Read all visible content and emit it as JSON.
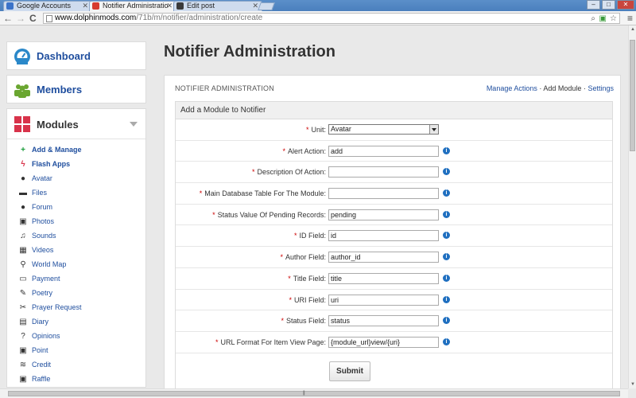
{
  "browser": {
    "tabs": [
      {
        "label": "Google Accounts",
        "active": false,
        "icon_color": "#3b73c9"
      },
      {
        "label": "Notifier Administratio",
        "active": true,
        "icon_color": "#d63b2f"
      },
      {
        "label": "Edit post",
        "active": false,
        "icon_color": "#3a3a3a"
      }
    ],
    "url_host": "www.dolphinmods.com",
    "url_path": "/71b/m/notifier/administration/create",
    "nav": {
      "back": "←",
      "forward": "→",
      "reload": "C"
    },
    "window": {
      "minimize": "–",
      "maximize": "□",
      "close": "✕"
    },
    "menu_glyph": "≡"
  },
  "sidebar": {
    "dashboard": {
      "label": "Dashboard",
      "icon": "speedometer-icon",
      "color": "#2a88c9"
    },
    "members": {
      "label": "Members",
      "icon": "people-icon",
      "color": "#6aa630"
    },
    "modules": {
      "label": "Modules",
      "icon": "grid-icon",
      "color": "#d8334a",
      "items": [
        {
          "label": "Add & Manage",
          "icon": "plus-icon",
          "glyph": "+",
          "color": "#1a9c3a",
          "bold": true
        },
        {
          "label": "Flash Apps",
          "icon": "lightning-icon",
          "glyph": "ϟ",
          "color": "#d8334a",
          "bold": true
        },
        {
          "label": "Avatar",
          "icon": "person-icon",
          "glyph": "●",
          "color": "#333",
          "bold": false
        },
        {
          "label": "Files",
          "icon": "disk-icon",
          "glyph": "▬",
          "color": "#333",
          "bold": false
        },
        {
          "label": "Forum",
          "icon": "chat-icon",
          "glyph": "●",
          "color": "#333",
          "bold": false
        },
        {
          "label": "Photos",
          "icon": "picture-icon",
          "glyph": "▣",
          "color": "#333",
          "bold": false
        },
        {
          "label": "Sounds",
          "icon": "music-icon",
          "glyph": "♫",
          "color": "#333",
          "bold": false
        },
        {
          "label": "Videos",
          "icon": "film-icon",
          "glyph": "▦",
          "color": "#333",
          "bold": false
        },
        {
          "label": "World Map",
          "icon": "map-pin-icon",
          "glyph": "⚲",
          "color": "#333",
          "bold": false
        },
        {
          "label": "Payment",
          "icon": "card-icon",
          "glyph": "▭",
          "color": "#333",
          "bold": false
        },
        {
          "label": "Poetry",
          "icon": "pencil-icon",
          "glyph": "✎",
          "color": "#333",
          "bold": false
        },
        {
          "label": "Prayer Request",
          "icon": "paperclip-icon",
          "glyph": "✂",
          "color": "#333",
          "bold": false
        },
        {
          "label": "Diary",
          "icon": "book-icon",
          "glyph": "▤",
          "color": "#333",
          "bold": false
        },
        {
          "label": "Opinions",
          "icon": "question-icon",
          "glyph": "?",
          "color": "#333",
          "bold": false
        },
        {
          "label": "Point",
          "icon": "coin-icon",
          "glyph": "▣",
          "color": "#333",
          "bold": false
        },
        {
          "label": "Credit",
          "icon": "stack-icon",
          "glyph": "≋",
          "color": "#333",
          "bold": false
        },
        {
          "label": "Raffle",
          "icon": "ticket-icon",
          "glyph": "▣",
          "color": "#333",
          "bold": false
        }
      ]
    }
  },
  "main": {
    "title": "Notifier Administration",
    "panel_title": "NOTIFIER ADMINISTRATION",
    "links": {
      "manage_actions": "Manage Actions",
      "add_module": "Add Module",
      "settings": "Settings"
    },
    "form": {
      "heading": "Add a Module to Notifier",
      "required_mark": "*",
      "unit": {
        "label": "Unit:",
        "value": "Avatar"
      },
      "fields": [
        {
          "label": "Alert Action:",
          "value": "add"
        },
        {
          "label": "Description Of Action:",
          "value": ""
        },
        {
          "label": "Main Database Table For The Module:",
          "value": ""
        },
        {
          "label": "Status Value Of Pending Records:",
          "value": "pending"
        },
        {
          "label": "ID Field:",
          "value": "id"
        },
        {
          "label": "Author Field:",
          "value": "author_id"
        },
        {
          "label": "Title Field:",
          "value": "title"
        },
        {
          "label": "URI Field:",
          "value": "uri"
        },
        {
          "label": "Status Field:",
          "value": "status"
        },
        {
          "label": "URL Format For Item View Page:",
          "value": "{module_url}view/{uri}"
        }
      ],
      "info_glyph": "i",
      "submit_label": "Submit"
    }
  }
}
